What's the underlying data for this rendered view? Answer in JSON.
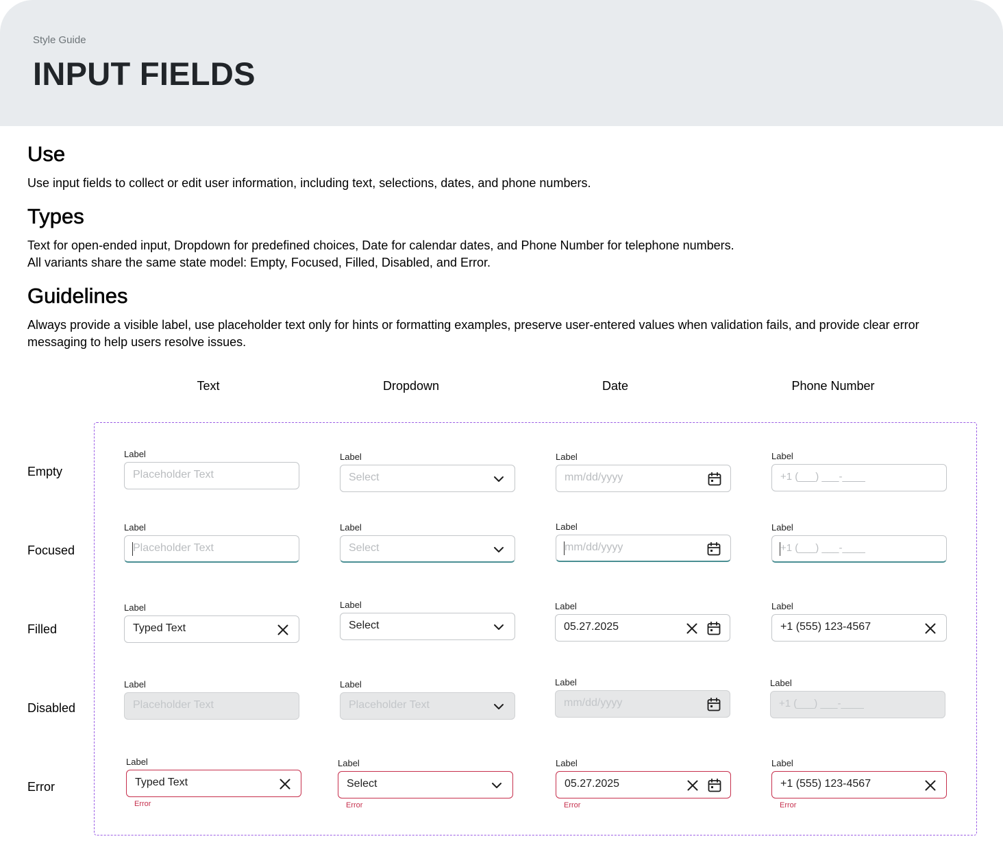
{
  "header": {
    "eyebrow": "Style Guide",
    "title": "INPUT FIELDS"
  },
  "sections": {
    "use": {
      "heading": "Use",
      "body": "Use input fields to collect or edit user information, including text, selections, dates, and phone numbers."
    },
    "types": {
      "heading": "Types",
      "body1": "Text for open-ended input, Dropdown for predefined choices, Date for calendar dates, and Phone Number for telephone numbers.",
      "body2": "All variants share the same state model: Empty, Focused, Filled, Disabled, and Error."
    },
    "guidelines": {
      "heading": "Guidelines",
      "body": "Always provide a visible label, use placeholder text only for hints or formatting examples, preserve user-entered values when validation fails, and provide clear error messaging to help users resolve issues."
    }
  },
  "columns": [
    "Text",
    "Dropdown",
    "Date",
    "Phone Number"
  ],
  "rows": [
    "Empty",
    "Focused",
    "Filled",
    "Disabled",
    "Error"
  ],
  "fields": {
    "label": "Label",
    "text_placeholder": "Placeholder Text",
    "select_placeholder": "Select",
    "date_placeholder": "mm/dd/yyyy",
    "phone_placeholder": "+1 (___) ___-____",
    "text_value": "Typed Text",
    "select_value": "Select",
    "date_value": "05.27.2025",
    "phone_value": "+1 (555) 123-4567",
    "dropdown_disabled_placeholder": "Placeholder Text",
    "error_message": "Error"
  },
  "colors": {
    "focus": "#4a8f93",
    "error": "#c62f4c",
    "frame": "#9b5de5",
    "header_bg": "#e8ebee"
  },
  "icons": [
    "chevron-down-icon",
    "calendar-icon",
    "close-icon"
  ]
}
